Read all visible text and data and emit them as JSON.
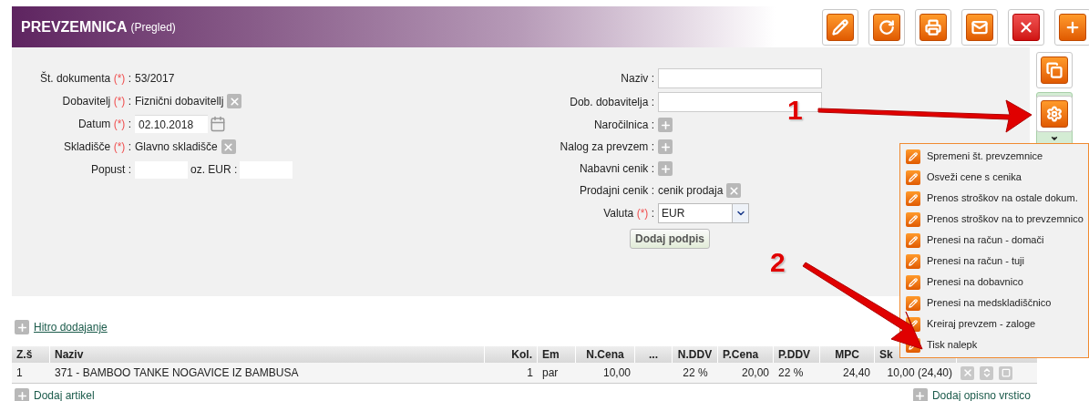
{
  "header": {
    "title": "PREVZEMNICA",
    "subtitle": "(Pregled)"
  },
  "toolbar": [
    {
      "kind": "edit"
    },
    {
      "kind": "refresh"
    },
    {
      "kind": "print"
    },
    {
      "kind": "mail"
    },
    {
      "kind": "delete"
    },
    {
      "kind": "add"
    }
  ],
  "side_tools": [
    {
      "kind": "copy"
    },
    {
      "kind": "settings",
      "expanded": true
    }
  ],
  "label_separator": ":",
  "form_left": [
    {
      "label": "Št. dokumenta",
      "required_mark": "(*)",
      "kind": "text",
      "value": "53/2017"
    },
    {
      "label": "Dobavitelj",
      "required_mark": "(*)",
      "kind": "removable",
      "value": "Fiznični dobavitellj"
    },
    {
      "label": "Datum",
      "required_mark": "(*)",
      "kind": "date",
      "value": "02.10.2018"
    },
    {
      "label": "Skladišče",
      "required_mark": "(*)",
      "kind": "removable",
      "value": "Glavno skladišče"
    },
    {
      "label": "Popust",
      "kind": "discount",
      "middle_label": "oz. EUR :"
    }
  ],
  "form_right": [
    {
      "label": "Naziv",
      "kind": "input"
    },
    {
      "label": "Dob. dobavitelja",
      "kind": "input"
    },
    {
      "label": "Naročilnica",
      "kind": "add"
    },
    {
      "label": "Nalog za prevzem",
      "kind": "add"
    },
    {
      "label": "Nabavni cenik",
      "kind": "add"
    },
    {
      "label": "Prodajni cenik",
      "kind": "removable",
      "value": "cenik prodaja"
    },
    {
      "label": "Valuta",
      "required_mark": "(*)",
      "kind": "select",
      "value": "EUR"
    }
  ],
  "sign_button": "Dodaj podpis",
  "quick_add_link": "Hitro dodajanje",
  "table": {
    "columns": [
      "Z.š",
      "Naziv",
      "Kol.",
      "Em",
      "N.Cena",
      "...",
      "N.DDV",
      "P.Cena",
      "P.DDV",
      "MPC",
      "Sk"
    ],
    "rows": [
      {
        "cells": [
          "1",
          "371 - BAMBOO TANKE NOGAVICE IZ BAMBUSA",
          "1",
          "par",
          "10,00",
          "",
          "22 %",
          "20,00",
          "22 %",
          "24,40",
          "10,00 (24,40)"
        ]
      }
    ]
  },
  "bottom_links": [
    "Dodaj artikel",
    "Dodaj opisno vrstico"
  ],
  "menu": {
    "items": [
      "Spremeni št. prevzemnice",
      "Osveži cene s cenika",
      "Prenos stroškov na ostale dokum.",
      "Prenos stroškov na to prevzemnico",
      "Prenesi na račun - domači",
      "Prenesi na račun - tuji",
      "Prenesi na dobavnico",
      "Prenesi na medskladiščnico",
      "Kreiraj prevzem - zaloge",
      "Tisk nalepk"
    ]
  },
  "annotations": [
    {
      "label": "1"
    },
    {
      "label": "2"
    }
  ]
}
